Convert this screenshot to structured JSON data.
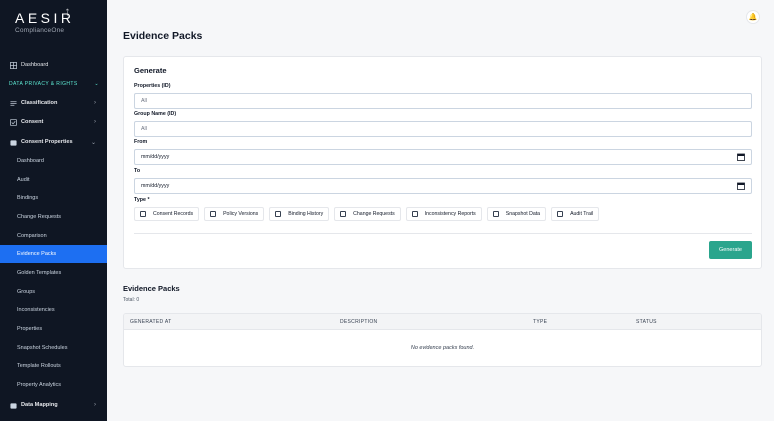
{
  "brand": {
    "name": "AESIR",
    "sub": "ComplianceOne"
  },
  "sidebar": {
    "dashboard": "Dashboard",
    "section": "DATA PRIVACY & RIGHTS",
    "classification": "Classification",
    "consent": "Consent",
    "consent_properties": "Consent Properties",
    "sub_items": [
      "Dashboard",
      "Audit",
      "Bindings",
      "Change Requests",
      "Comparison",
      "Evidence Packs",
      "Golden Templates",
      "Groups",
      "Inconsistencies",
      "Properties",
      "Snapshot Schedules",
      "Template Rollouts",
      "Property Analytics"
    ],
    "active_index": 5,
    "data_mapping": "Data Mapping"
  },
  "page": {
    "title": "Evidence Packs"
  },
  "generate": {
    "title": "Generate",
    "properties_label": "Properties (ID)",
    "properties_value": "All",
    "group_label": "Group Name (ID)",
    "group_value": "All",
    "from_label": "From",
    "from_value": "mm/dd/yyyy",
    "to_label": "To",
    "to_value": "mm/dd/yyyy",
    "type_label": "Type *",
    "types": [
      "Consent Records",
      "Policy Versions",
      "Binding History",
      "Change Requests",
      "Inconsistency Reports",
      "Snapshot Data",
      "Audit Trail"
    ],
    "button": "Generate"
  },
  "packs": {
    "title": "Evidence Packs",
    "total": "Total: 0",
    "columns": [
      "GENERATED AT",
      "DESCRIPTION",
      "TYPE",
      "STATUS"
    ],
    "empty": "No evidence packs found."
  },
  "colors": {
    "sidebar_bg": "#0f1623",
    "active": "#1d6ff2",
    "accent": "#2aa58d",
    "section": "#5eead4"
  }
}
